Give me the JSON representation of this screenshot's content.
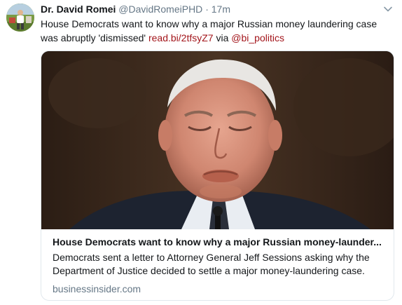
{
  "tweet": {
    "author_name": "Dr. David Romei",
    "author_handle": "@DavidRomeiPHD",
    "separator": "·",
    "timestamp": "17m",
    "text_main": "House Democrats want to know why a major Russian money laundering case was abruptly 'dismissed' ",
    "link_text": "read.bi/2tfsyZ7",
    "via_text": " via ",
    "mention_text": "@bi_politics"
  },
  "card": {
    "title": "House Democrats want to know why a major Russian money-launder...",
    "description": "Democrats sent a letter to Attorney General Jeff Sessions asking why the Department of Justice decided to settle a major money-laundering case.",
    "domain": "businessinsider.com"
  },
  "icons": {
    "caret": "chevron-down-icon"
  },
  "colors": {
    "link": "#a3151b",
    "muted": "#657786",
    "text": "#14171a",
    "border": "#e1e8ed"
  }
}
